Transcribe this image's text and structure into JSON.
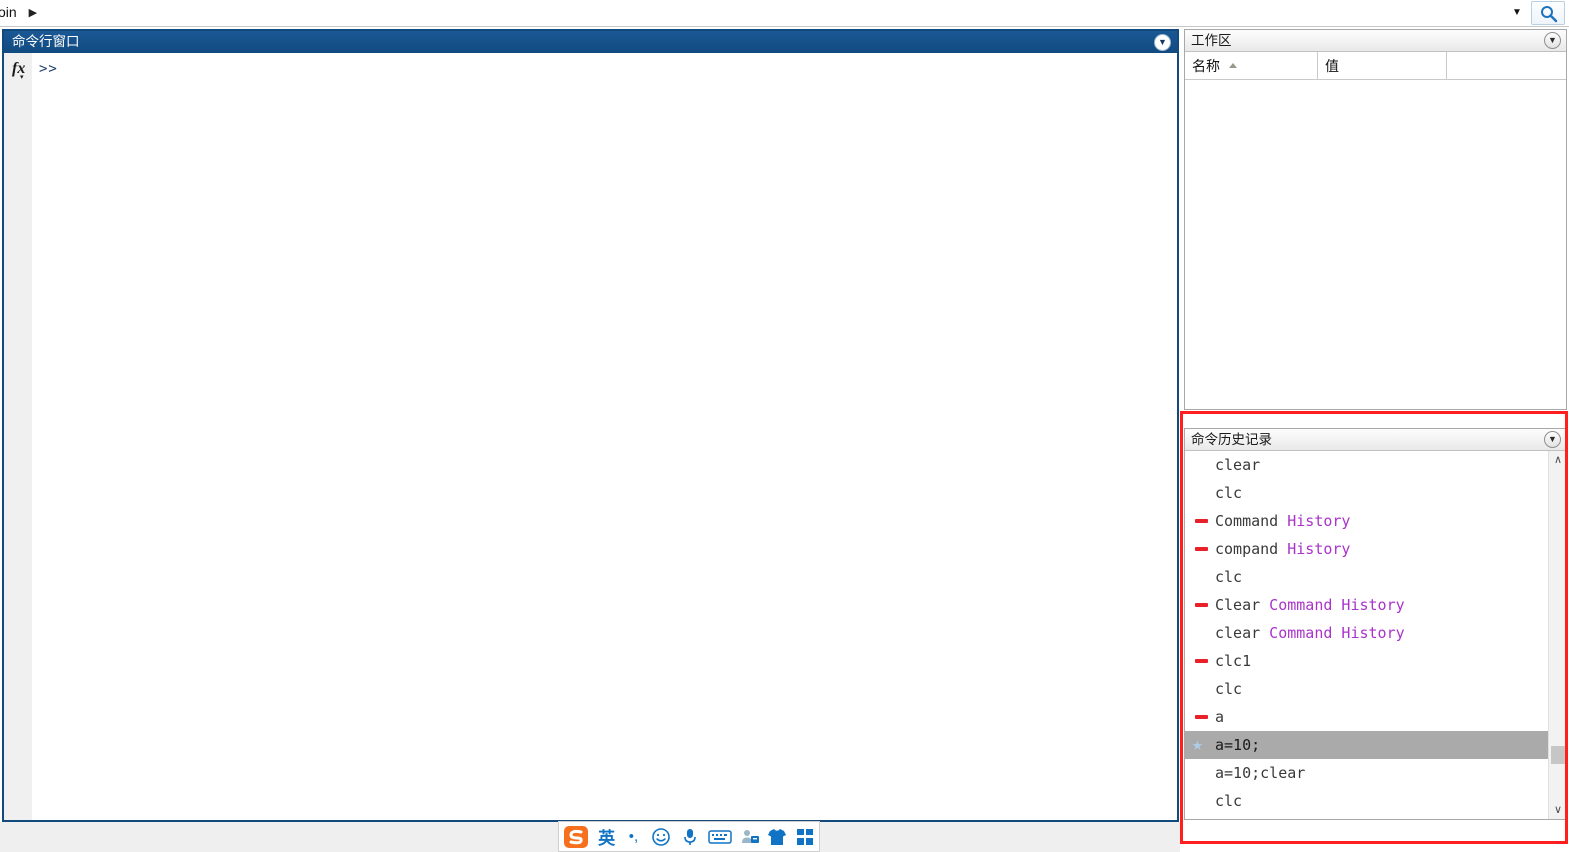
{
  "toolbar": {
    "breadcrumb_text": "oin",
    "breadcrumb_arrow": "▶",
    "dropdown_icon": "▼",
    "search_icon_name": "search-icon"
  },
  "command_window": {
    "title": "命令行窗口",
    "panel_menu_icon": "▼",
    "fx_label": "fx",
    "fx_caret": "▾",
    "prompt": ">>"
  },
  "workspace": {
    "title": "工作区",
    "panel_menu_icon": "▼",
    "columns": [
      {
        "label": "名称",
        "sorted": "asc"
      },
      {
        "label": "值",
        "sorted": ""
      },
      {
        "label": "",
        "sorted": ""
      }
    ],
    "rows": []
  },
  "command_history": {
    "title": "命令历史记录",
    "panel_menu_icon": "▼",
    "entries": [
      {
        "main": "clear",
        "arg": "",
        "marker": "none",
        "selected": false
      },
      {
        "main": "clc",
        "arg": "",
        "marker": "none",
        "selected": false
      },
      {
        "main": "Command",
        "arg": "History",
        "marker": "error",
        "selected": false
      },
      {
        "main": "compand",
        "arg": "History",
        "marker": "error",
        "selected": false
      },
      {
        "main": "clc",
        "arg": "",
        "marker": "none",
        "selected": false
      },
      {
        "main": "Clear",
        "arg": "Command History",
        "marker": "error",
        "selected": false
      },
      {
        "main": "clear",
        "arg": "Command History",
        "marker": "none",
        "selected": false
      },
      {
        "main": "clc1",
        "arg": "",
        "marker": "error",
        "selected": false
      },
      {
        "main": "clc",
        "arg": "",
        "marker": "none",
        "selected": false
      },
      {
        "main": "a",
        "arg": "",
        "marker": "error",
        "selected": false
      },
      {
        "main": "a=10;",
        "arg": "",
        "marker": "favorite",
        "selected": true
      },
      {
        "main": "a=10;clear",
        "arg": "",
        "marker": "none",
        "selected": false
      },
      {
        "main": "clc",
        "arg": "",
        "marker": "none",
        "selected": false
      }
    ],
    "scrollbar": {
      "up_icon": "∧",
      "down_icon": "∨"
    },
    "favorite_icon": "★"
  },
  "annotation": {
    "color": "#ff1f1f"
  },
  "ime_toolbar": {
    "logo_label": "S",
    "mode_label": "英",
    "punctuation_label": "•,",
    "emoji_icon": "emoji-icon",
    "mic_icon": "microphone-icon",
    "keyboard_icon": "keyboard-icon",
    "user_icon": "user-icon",
    "skin_icon": "shirt-icon",
    "apps_icon": "apps-grid-icon"
  },
  "colors": {
    "active_panel_title": "#124a7e",
    "command_arg_purple": "#aa33cc",
    "error_marker_red": "#e8202a",
    "selection_gray": "#aaaaaa",
    "favorite_star_blue": "#aecde8"
  }
}
